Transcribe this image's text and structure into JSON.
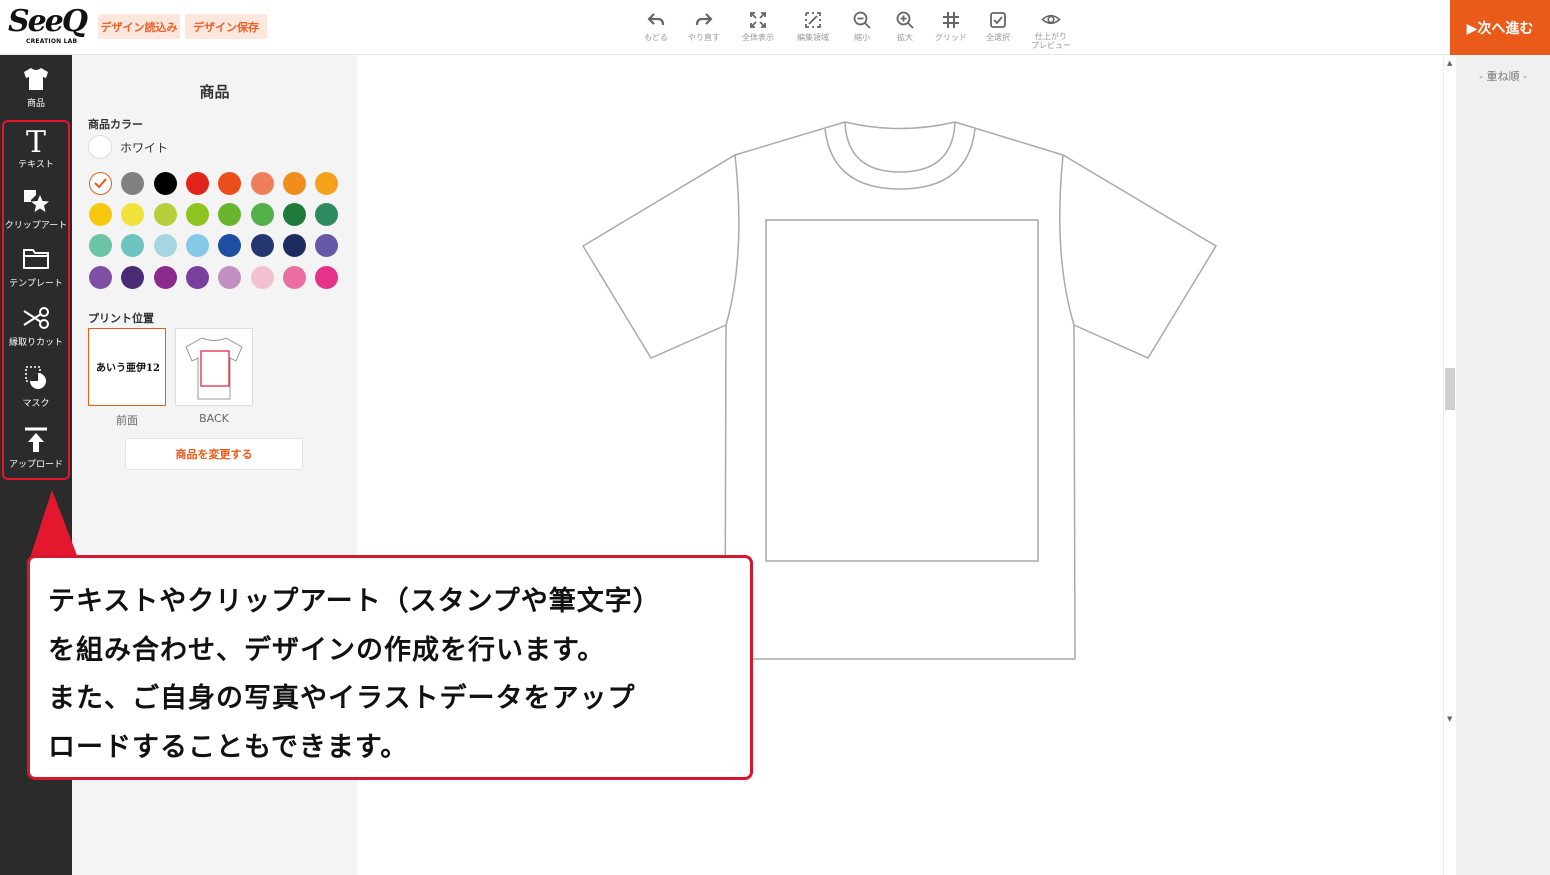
{
  "header": {
    "logo_text": "SeeQ",
    "logo_sub": "CREATION LAB",
    "load_design": "デザイン読込み",
    "save_design": "デザイン保存",
    "next_button": "▶次へ進む"
  },
  "toolbar": [
    {
      "label": "もどる",
      "icon": "undo-icon"
    },
    {
      "label": "やり直す",
      "icon": "redo-icon"
    },
    {
      "label": "全体表示",
      "icon": "fit-view-icon"
    },
    {
      "label": "編集領域",
      "icon": "edit-area-icon"
    },
    {
      "label": "縮小",
      "icon": "zoom-out-icon"
    },
    {
      "label": "拡大",
      "icon": "zoom-in-icon"
    },
    {
      "label": "グリッド",
      "icon": "grid-icon"
    },
    {
      "label": "全選択",
      "icon": "select-all-icon"
    },
    {
      "label": "仕上がり\nプレビュー",
      "icon": "eye-icon"
    }
  ],
  "nav": [
    {
      "label": "商品",
      "icon": "tshirt-icon"
    },
    {
      "label": "テキスト",
      "icon": "text-icon"
    },
    {
      "label": "クリップアート",
      "icon": "clipart-icon"
    },
    {
      "label": "テンプレート",
      "icon": "folder-icon"
    },
    {
      "label": "縁取りカット",
      "icon": "scissors-icon"
    },
    {
      "label": "マスク",
      "icon": "mask-icon"
    },
    {
      "label": "アップロード",
      "icon": "upload-icon"
    }
  ],
  "panel": {
    "title": "商品",
    "color_label": "商品カラー",
    "selected_color": "ホワイト",
    "colors": [
      "#ffffff",
      "#808080",
      "#000000",
      "#e2231a",
      "#e94e1b",
      "#ee7f5a",
      "#f08d1c",
      "#f4a21e",
      "#f6c90e",
      "#f0e23a",
      "#b5d03a",
      "#8fc31f",
      "#6ab42d",
      "#54b04a",
      "#1f7a3c",
      "#2e8a5f",
      "#6cc3a5",
      "#6cc3c0",
      "#a8d5e2",
      "#86c8e8",
      "#1f4fa3",
      "#263670",
      "#1e2b5e",
      "#6658a6",
      "#7d4fa5",
      "#4b2a76",
      "#8a2b8d",
      "#7a3f9d",
      "#c28fc3",
      "#f3c0cf",
      "#ea6fa0",
      "#e6338a"
    ],
    "print_position_label": "プリント位置",
    "front_sample_text": "あいう亜伊12",
    "positions": [
      "前面",
      "BACK"
    ],
    "change_product": "商品を変更する"
  },
  "layers": {
    "label": "- 重ね順 -"
  },
  "callout": {
    "lines": [
      "テキストやクリップアート（スタンプや筆文字）",
      "を組み合わせ、デザインの作成を行います。",
      "また、ご自身の写真やイラストデータをアップ",
      "ロードすることもできます。"
    ]
  }
}
